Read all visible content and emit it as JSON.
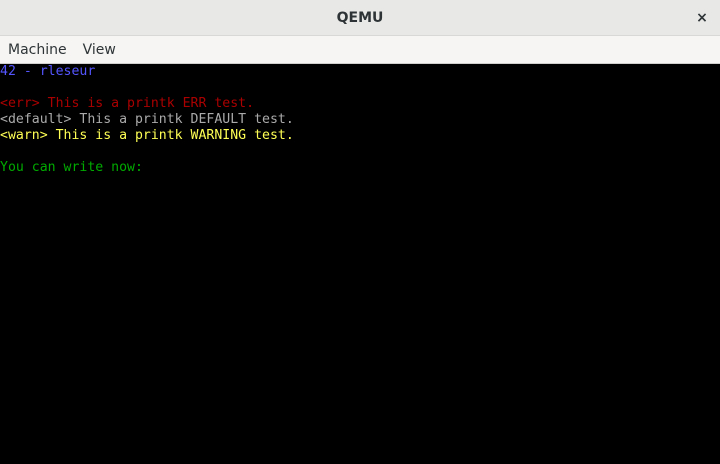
{
  "window": {
    "title": "QEMU",
    "close_label": "×"
  },
  "menu": {
    "items": [
      {
        "label": "Machine"
      },
      {
        "label": "View"
      }
    ]
  },
  "terminal": {
    "lines": [
      {
        "text": "42 - rleseur",
        "color": "#5555ff"
      },
      {
        "text": "<err> This is a printk ERR test.",
        "color": "#aa0000"
      },
      {
        "text": "<default> This a printk DEFAULT test.",
        "color": "#aaaaaa"
      },
      {
        "text": "<warn> This is a printk WARNING test.",
        "color": "#ffff55"
      },
      {
        "text": "You can write now:",
        "color": "#00aa00"
      }
    ]
  }
}
